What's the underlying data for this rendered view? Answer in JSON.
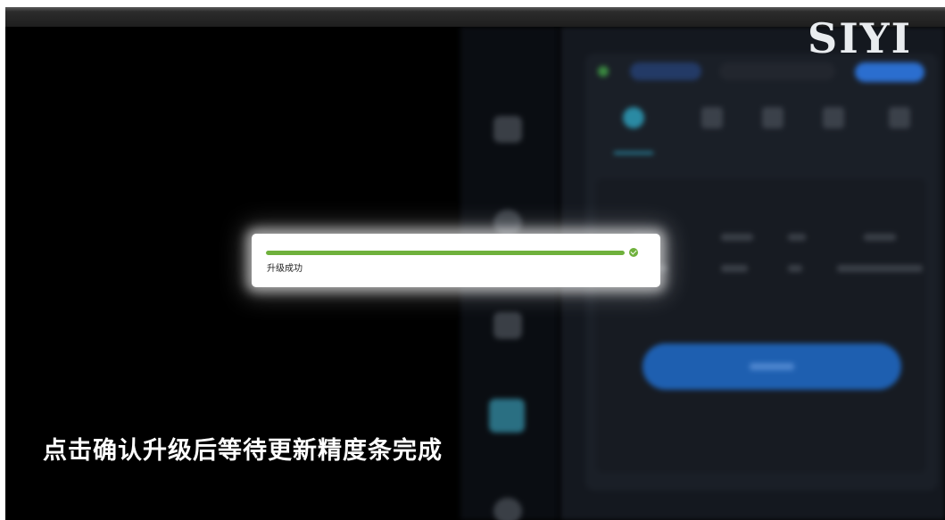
{
  "brand": {
    "logo_text": "SIYI"
  },
  "dialog": {
    "status_text": "升级成功",
    "progress": 1.0,
    "progress_color": "#6fb13c",
    "complete_icon": "check-circle-icon"
  },
  "subtitle": {
    "text": "点击确认升级后等待更新精度条完成"
  },
  "background_app": {
    "rail_icons": [
      "camera-icon",
      "target-icon",
      "star-icon",
      "grid-icon",
      "circle-icon"
    ],
    "accent_color": "#2b6ecf"
  }
}
